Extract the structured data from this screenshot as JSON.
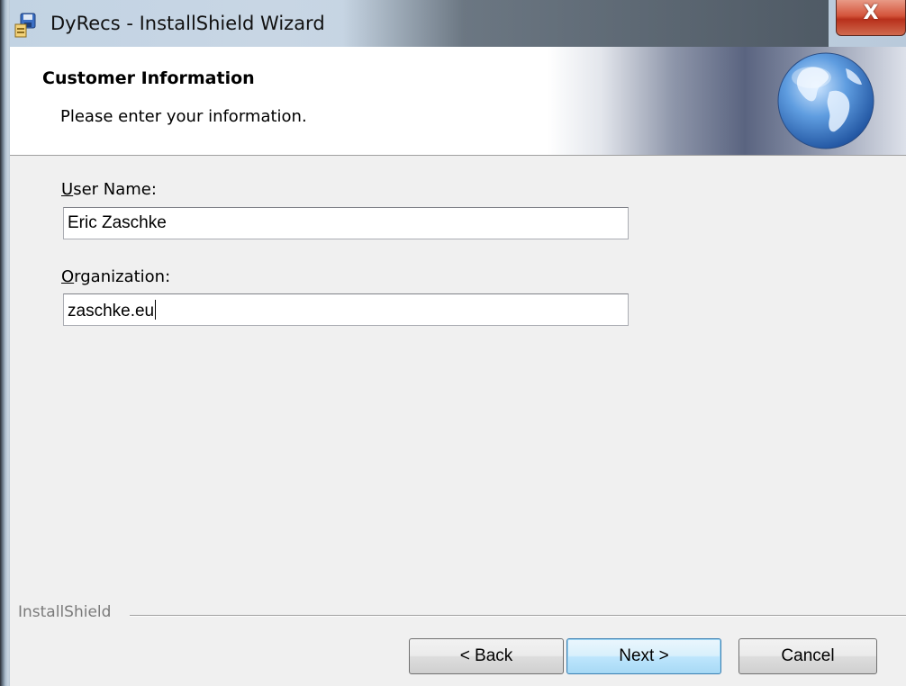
{
  "window": {
    "title": "DyRecs - InstallShield Wizard",
    "close_glyph": "X",
    "app_icon": "installer-icon",
    "colors": {
      "close_button": "#c9422a",
      "dialog_bg": "#f0f0f0",
      "banner_bg": "#ffffff",
      "default_button": "#3c7fb1"
    }
  },
  "banner": {
    "title": "Customer Information",
    "subtitle": "Please enter your information.",
    "graphic": "globe-icon"
  },
  "form": {
    "user_name": {
      "label_accel": "U",
      "label_rest": "ser Name:",
      "value": "Eric Zaschke"
    },
    "organization": {
      "label_accel": "O",
      "label_rest": "rganization:",
      "value": "zaschke.eu"
    }
  },
  "footer": {
    "brand": "InstallShield",
    "back_label": "< Back",
    "next_label": "Next >",
    "cancel_label": "Cancel"
  }
}
